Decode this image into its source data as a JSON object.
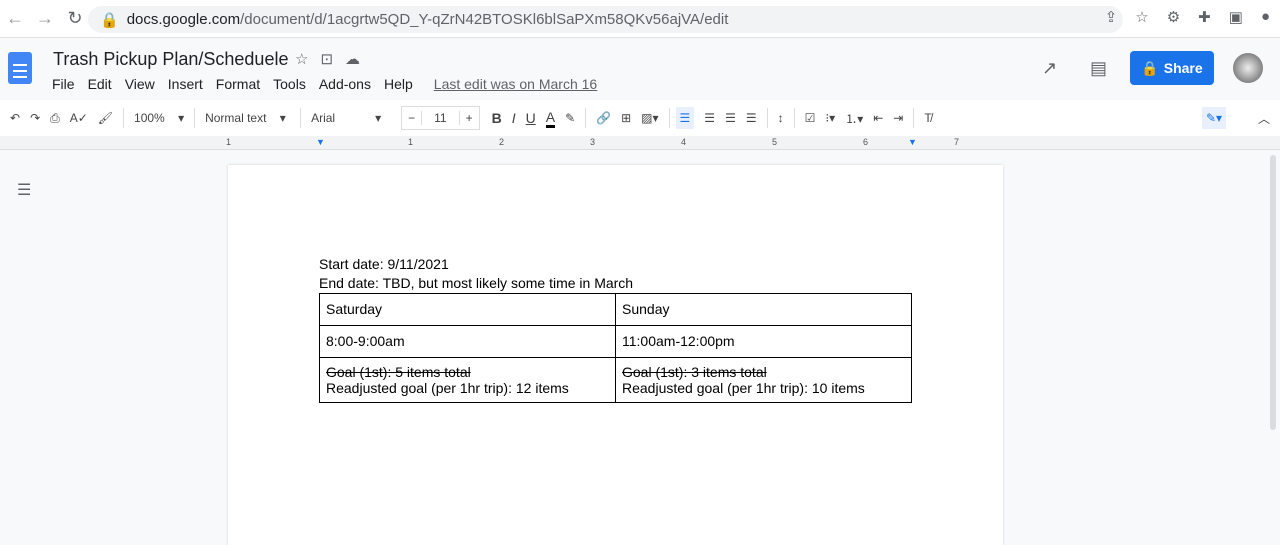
{
  "browser": {
    "url_domain": "docs.google.com",
    "url_path": "/document/d/1acgrtw5QD_Y-qZrN42BTOSKl6blSaPXm58QKv56ajVA/edit"
  },
  "doc": {
    "title": "Trash Pickup Plan/Scheduele",
    "last_edit": "Last edit was on March 16",
    "share": "Share"
  },
  "menu": [
    "File",
    "Edit",
    "View",
    "Insert",
    "Format",
    "Tools",
    "Add-ons",
    "Help"
  ],
  "toolbar": {
    "zoom": "100%",
    "style": "Normal text",
    "font": "Arial",
    "size": "11",
    "minus": "−",
    "plus": "+"
  },
  "ruler": [
    "1",
    "1",
    "2",
    "3",
    "4",
    "5",
    "6",
    "7"
  ],
  "content": {
    "start": "Start date: 9/11/2021",
    "end": "End date: TBD, but most likely some time in March",
    "table": [
      [
        "Saturday",
        "Sunday"
      ],
      [
        "8:00-9:00am",
        "11:00am-12:00pm"
      ]
    ],
    "goals": [
      {
        "struck": "Goal (1st): 5 items total",
        "readjusted": "Readjusted goal (per 1hr trip): 12 items"
      },
      {
        "struck": "Goal (1st): 3 items total",
        "readjusted": "Readjusted goal (per 1hr trip): 10 items"
      }
    ]
  }
}
